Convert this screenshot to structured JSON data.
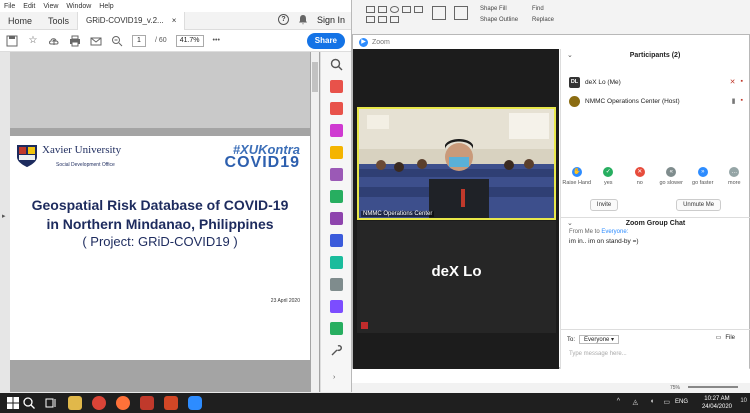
{
  "acrobat": {
    "menu": [
      "File",
      "Edit",
      "View",
      "Window",
      "Help"
    ],
    "tabs": {
      "home": "Home",
      "tools": "Tools",
      "doc": "GRiD-COVID19_v.2...",
      "close": "×"
    },
    "help_glyph": "?",
    "sign_in": "Sign In",
    "toolbar": {
      "page_current": "1",
      "page_total": "/ 60",
      "zoom": "41.7%",
      "more": "•••",
      "share": "Share"
    },
    "page": {
      "org_name": "Xavier University",
      "org_sub": "Social Development Office",
      "hashtag": "#XUKontra",
      "covid": "COVID19",
      "title_line1": "Geospatial Risk Database of COVID-19",
      "title_line2": "in Northern Mindanao, Philippines",
      "subtitle": "( Project: GRiD-COVID19 )",
      "date": "23 April 2020"
    }
  },
  "powerpoint": {
    "shape_fill": "Shape Fill",
    "shape_outline": "Shape Outline",
    "find": "Find",
    "replace": "Replace",
    "zoom_pct": "75%"
  },
  "zoom": {
    "window_title": "Zoom",
    "participants_title": "Participants (2)",
    "participants": [
      {
        "initials": "DL",
        "name": "deX Lo (Me)"
      },
      {
        "initials": "",
        "name": "NMMC Operations Center (Host)"
      }
    ],
    "video": {
      "tile_label": "NMMC Operations Center",
      "name_tile": "deX Lo"
    },
    "reactions": [
      {
        "label": "Raise Hand",
        "color": "#2d8cff"
      },
      {
        "label": "yes",
        "color": "#27ae60"
      },
      {
        "label": "no",
        "color": "#e74c3c"
      },
      {
        "label": "go slower",
        "color": "#7f8c8d"
      },
      {
        "label": "go faster",
        "color": "#2d8cff"
      },
      {
        "label": "more",
        "color": "#95a5a6"
      }
    ],
    "buttons": {
      "invite": "Invite",
      "unmute": "Unmute Me"
    },
    "chat": {
      "title": "Zoom Group Chat",
      "from": "From Me to",
      "to": "Everyone:",
      "message": "im in.. im on stand-by =)",
      "to_label": "To:",
      "to_value": "Everyone",
      "file": "File",
      "placeholder": "Type message here..."
    }
  },
  "taskbar": {
    "lang": "ENG",
    "time": "10:27 AM",
    "date": "24/04/2020",
    "notif": "10"
  }
}
